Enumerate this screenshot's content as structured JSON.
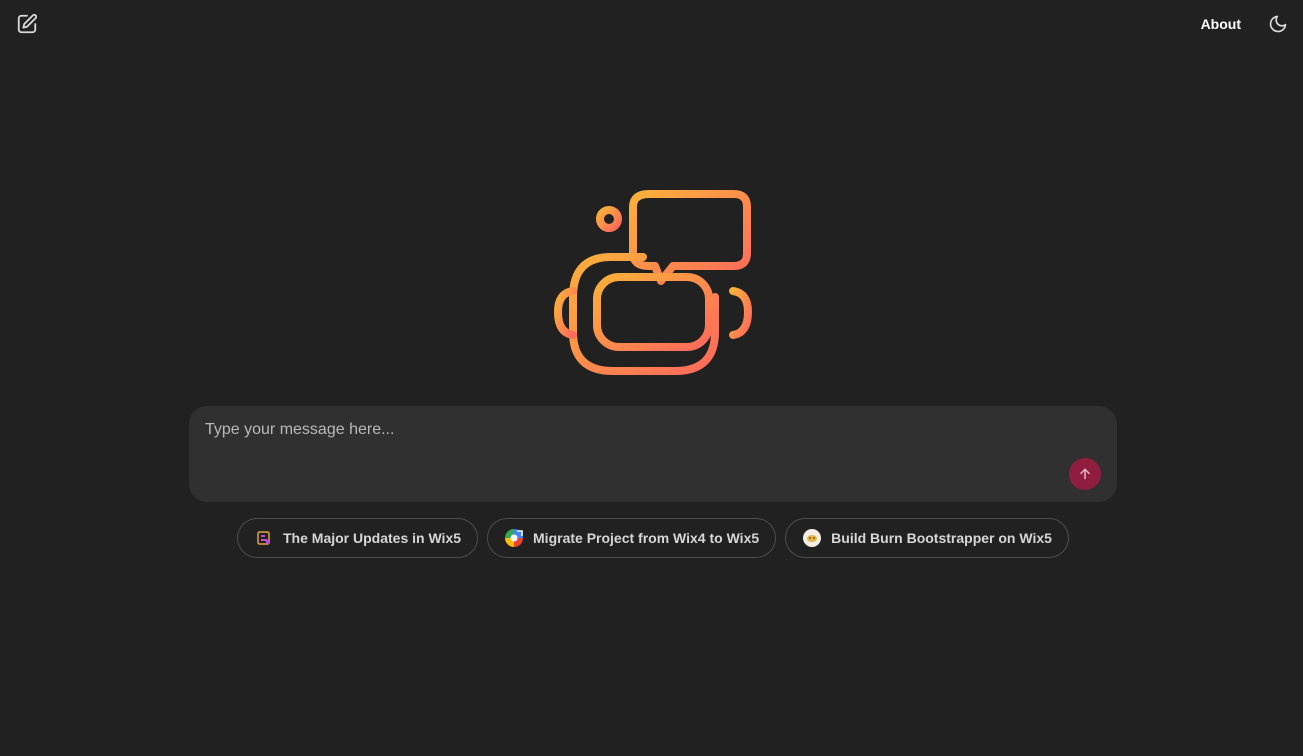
{
  "header": {
    "new_chat_icon": "new-chat-icon",
    "about_label": "About",
    "theme_icon": "moon-icon"
  },
  "hero": {
    "logo_icon": "robot-chat-icon",
    "gradient": [
      "#fbb03b",
      "#ff6a5b"
    ]
  },
  "composer": {
    "placeholder": "Type your message here...",
    "value": "",
    "send_icon": "arrow-up-icon",
    "send_color": "#8f1d3f"
  },
  "suggestions": [
    {
      "label": "The Major Updates in Wix5",
      "icon": "wix5-icon"
    },
    {
      "label": "Migrate Project from Wix4 to Wix5",
      "icon": "migrate-icon"
    },
    {
      "label": "Build Burn Bootstrapper on Wix5",
      "icon": "burn-icon"
    }
  ]
}
